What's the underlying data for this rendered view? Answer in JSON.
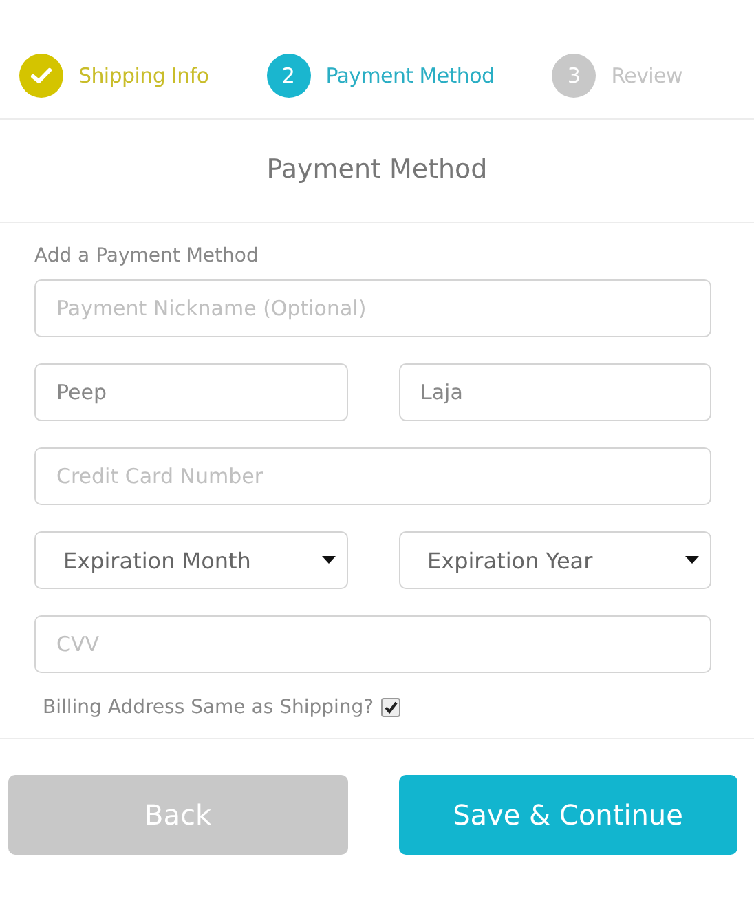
{
  "steps": [
    {
      "label": "Shipping Info",
      "kind": "done"
    },
    {
      "label": "Payment Method",
      "kind": "current",
      "number": "2"
    },
    {
      "label": "Review",
      "kind": "upcoming",
      "number": "3"
    }
  ],
  "heading": "Payment Method",
  "section_label": "Add a Payment Method",
  "rows": [
    [
      {
        "kind": "input",
        "placeholder": "Payment Nickname (Optional)"
      }
    ],
    [
      {
        "kind": "input",
        "value": "Peep"
      },
      {
        "kind": "input",
        "value": "Laja"
      }
    ],
    [
      {
        "kind": "input",
        "placeholder": "Credit Card Number"
      }
    ],
    [
      {
        "kind": "select",
        "value": "Expiration Month"
      },
      {
        "kind": "select",
        "value": "Expiration Year"
      }
    ],
    [
      {
        "kind": "input",
        "placeholder": "CVV"
      }
    ]
  ],
  "billing_same": {
    "label": "Billing Address Same as Shipping?",
    "checked": true
  },
  "buttons": [
    {
      "label": "Back",
      "kind": "secondary"
    },
    {
      "label": "Save & Continue",
      "kind": "primary"
    }
  ]
}
